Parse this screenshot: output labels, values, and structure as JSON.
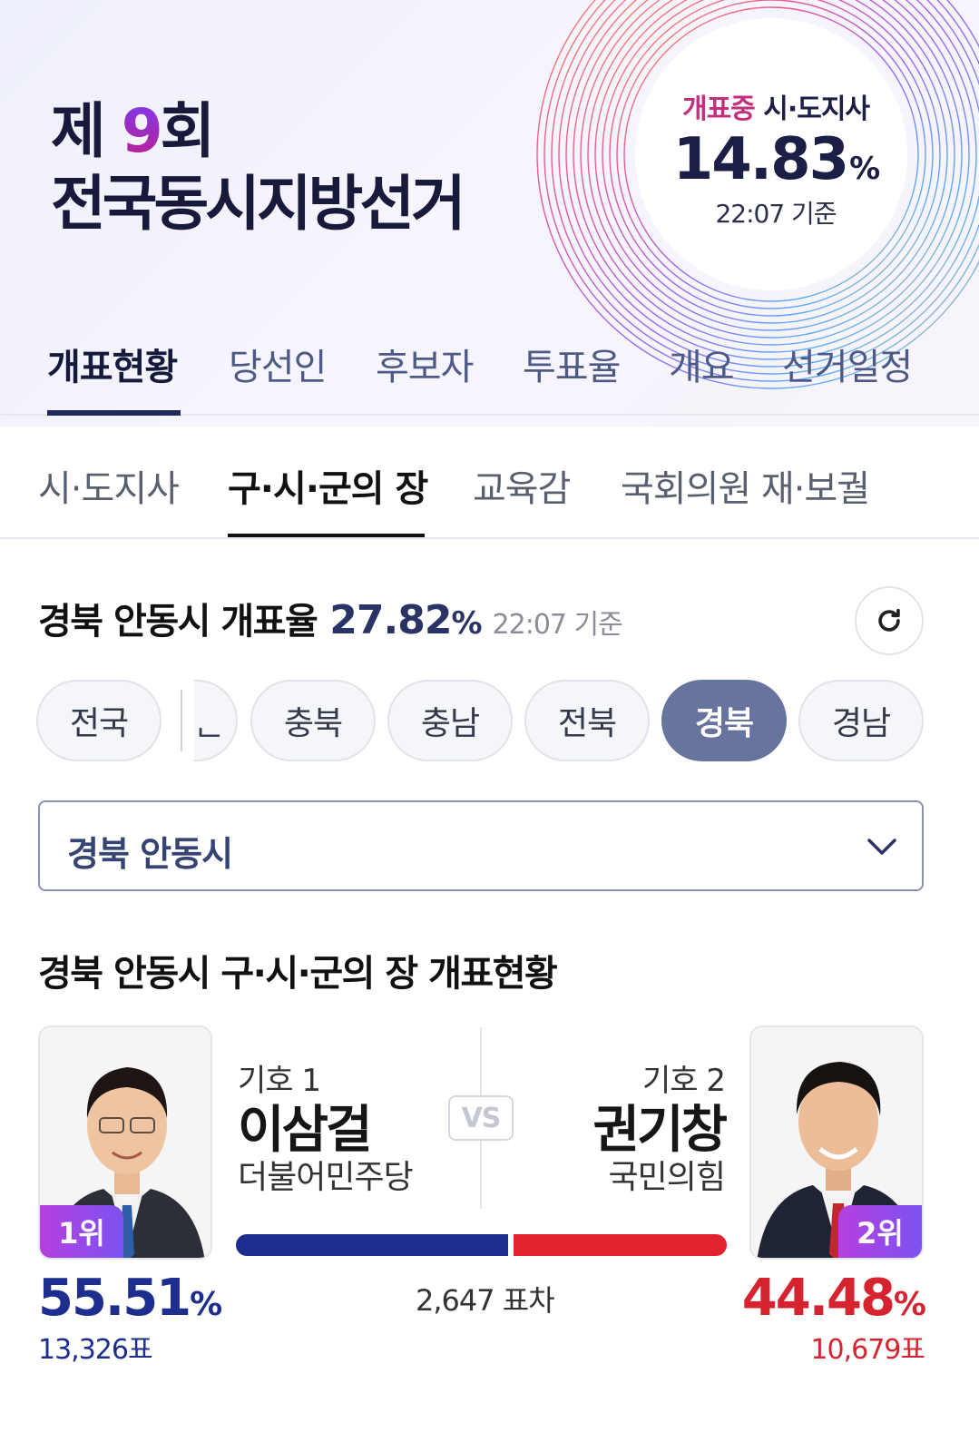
{
  "header": {
    "title_prefix": "제 ",
    "title_number": "9",
    "title_suffix": "회",
    "title_line2": "전국동시지방선거",
    "count_label_highlight": "개표중",
    "count_label_rest": " 시·도지사",
    "count_value": "14.83",
    "count_unit": "%",
    "count_time": "22:07 기준"
  },
  "main_nav": [
    "개표현황",
    "당선인",
    "후보자",
    "투표율",
    "개요",
    "선거일정"
  ],
  "sub_nav": [
    "시·도지사",
    "구·시·군의 장",
    "교육감",
    "국회의원 재·보궐"
  ],
  "rate": {
    "title": "경북 안동시 개표율",
    "value": "27.82",
    "unit": "%",
    "time": "22:07 기준"
  },
  "regions": {
    "first": "전국",
    "partial": "ᆫ",
    "items": [
      "충북",
      "충남",
      "전북",
      "경북",
      "경남"
    ],
    "selected": "경북"
  },
  "select": {
    "value": "경북 안동시"
  },
  "section_title": "경북 안동시 구·시·군의 장 개표현황",
  "candidates": {
    "left": {
      "number": "기호 1",
      "name": "이삼걸",
      "party": "더불어민주당",
      "rank": "1위",
      "percent": "55.51",
      "votes": "13,326표",
      "color": "#1d2e8e"
    },
    "right": {
      "number": "기호 2",
      "name": "권기창",
      "party": "국민의힘",
      "rank": "2위",
      "percent": "44.48",
      "votes": "10,679표",
      "color": "#d62330"
    },
    "vs": "VS",
    "difference": "2,647 표차",
    "percent_unit": "%"
  }
}
